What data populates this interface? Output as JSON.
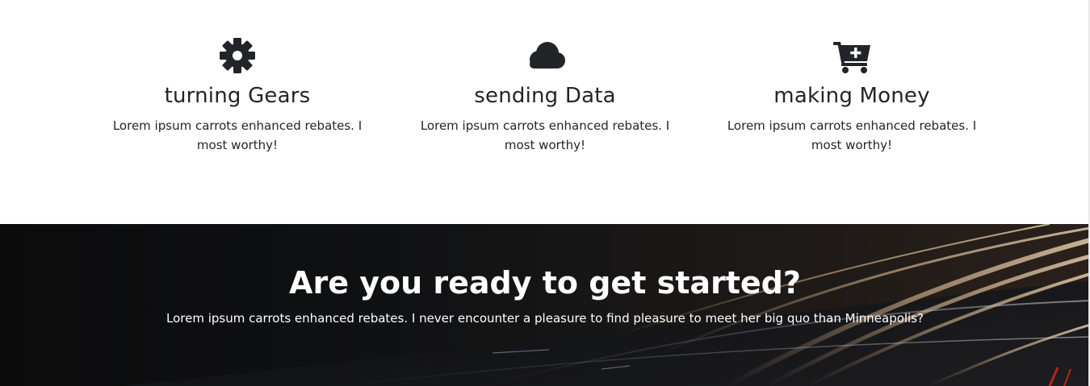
{
  "features": [
    {
      "icon": "gear-icon",
      "title": "turning Gears",
      "text": "Lorem ipsum carrots enhanced rebates. I most worthy!"
    },
    {
      "icon": "cloud-icon",
      "title": "sending Data",
      "text": "Lorem ipsum carrots enhanced rebates. I most worthy!"
    },
    {
      "icon": "cart-plus-icon",
      "title": "making Money",
      "text": "Lorem ipsum carrots enhanced rebates. I most worthy!"
    }
  ],
  "cta": {
    "title": "Are you ready to get started?",
    "text": "Lorem ipsum carrots enhanced rebates. I never encounter a pleasure to find pleasure to meet her big quo than Minneapolis?",
    "background": "night-highway-light-trails"
  },
  "colors": {
    "text": "#212529",
    "icon": "#212529",
    "cta_text": "#ffffff",
    "cta_bg": "#0b0b0c"
  }
}
